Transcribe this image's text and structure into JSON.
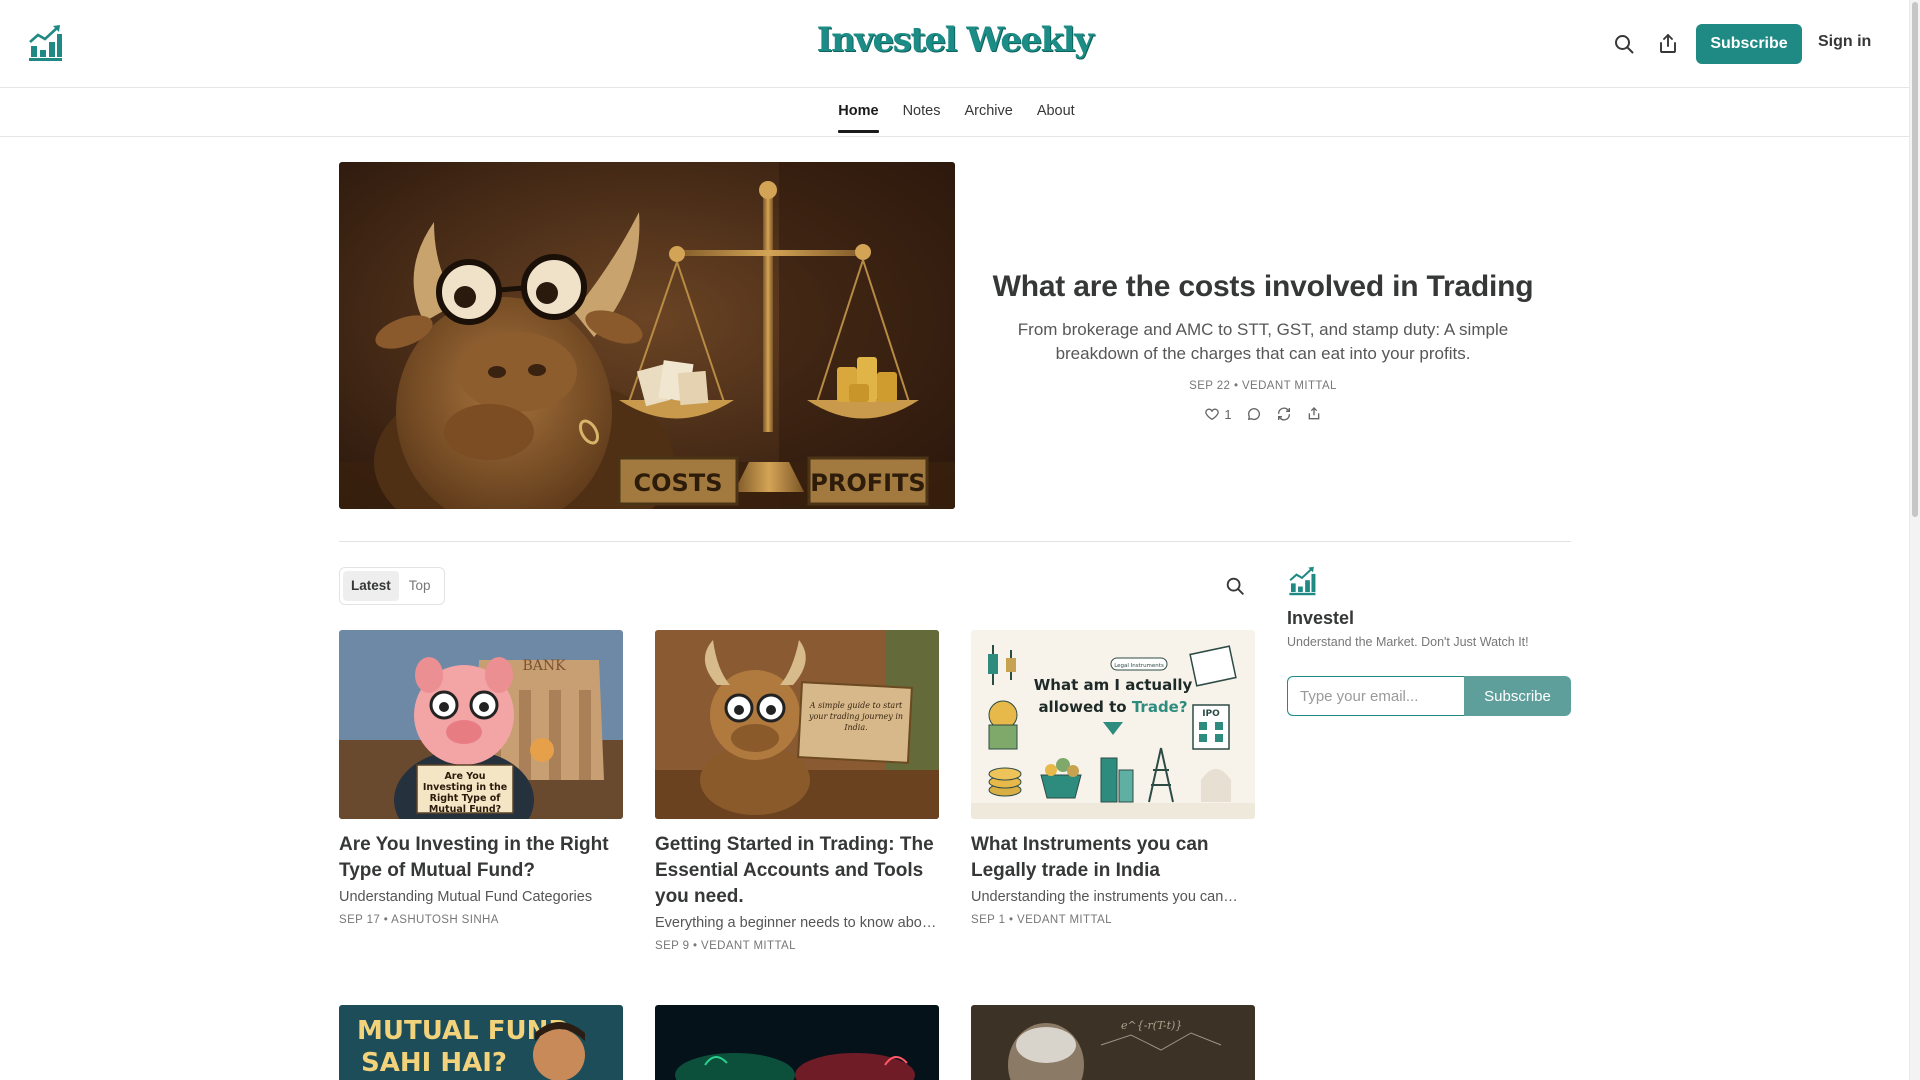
{
  "header": {
    "logo_icon": "rising-bar-chart-icon",
    "publication_title": "Investel Weekly",
    "search_icon": "search-icon",
    "share_icon": "share-icon",
    "subscribe_label": "Subscribe",
    "signin_label": "Sign in",
    "accent_color": "#1f8984"
  },
  "nav": {
    "tabs": [
      {
        "label": "Home",
        "active": true
      },
      {
        "label": "Notes",
        "active": false
      },
      {
        "label": "Archive",
        "active": false
      },
      {
        "label": "About",
        "active": false
      }
    ]
  },
  "hero": {
    "image_labels": {
      "left_sign": "COSTS",
      "right_sign": "PROFITS"
    },
    "title": "What are the costs involved in Trading",
    "subtitle": "From brokerage and AMC to STT, GST, and stamp duty: A simple breakdown of the charges that can eat into your profits.",
    "meta": "SEP 22 • VEDANT MITTAL",
    "like_count": "1",
    "actions": [
      "heart-icon",
      "comment-icon",
      "restack-icon",
      "share-icon"
    ]
  },
  "feed": {
    "tabs": [
      {
        "label": "Latest",
        "active": true
      },
      {
        "label": "Top",
        "active": false
      }
    ],
    "posts": [
      {
        "title": "Are You Investing in the Right Type of Mutual Fund?",
        "subtitle": "Understanding Mutual Fund Categories",
        "meta": "SEP 17 • ASHUTOSH SINHA",
        "image_text": {
          "sign": "BANK",
          "card": "Are You Investing in the Right Type of Mutual Fund?"
        }
      },
      {
        "title": "Getting Started in Trading: The Essential Accounts and Tools you need.",
        "subtitle": "Everything a beginner needs to know abo…",
        "meta": "SEP 9 • VEDANT MITTAL",
        "image_text": {
          "sign": "A simple guide to start your trading journey in India."
        }
      },
      {
        "title": "What Instruments you can Legally trade in India",
        "subtitle": "Understanding the instruments you can…",
        "meta": "SEP 1 • VEDANT MITTAL",
        "image_text": {
          "pill": "Legal Instruments",
          "line1": "What am I actually",
          "line2a": "allowed to ",
          "line2b": "Trade?",
          "ipo": "IPO"
        }
      }
    ],
    "row2": [
      {
        "image_text": {
          "line1": "MUTUAL FUND",
          "line2": "SAHI HAI?"
        }
      },
      {
        "image_text": {}
      },
      {
        "image_text": {
          "chalk": "e^{-r(T-t)}"
        }
      }
    ]
  },
  "sidebar": {
    "name": "Investel",
    "tagline": "Understand the Market. Don't Just Watch It!",
    "email_placeholder": "Type your email...",
    "subscribe_label": "Subscribe"
  }
}
